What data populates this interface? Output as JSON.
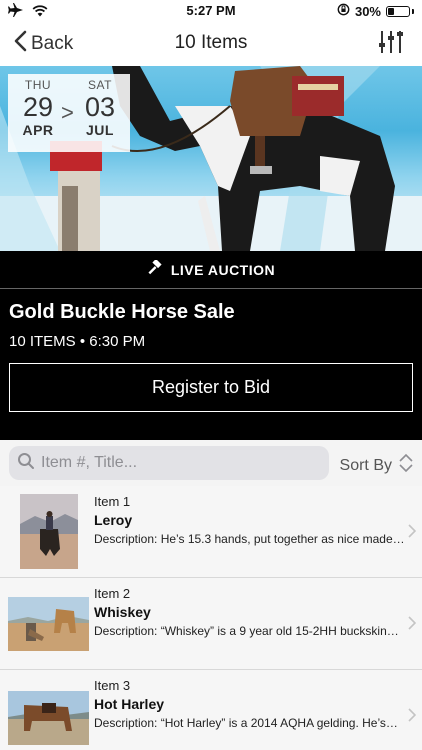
{
  "status_bar": {
    "time": "5:27 PM",
    "battery_text": "30%",
    "battery_level": 0.3,
    "icons": [
      "airplane-icon",
      "wifi-icon",
      "orientation-lock-icon",
      "battery-icon"
    ]
  },
  "nav": {
    "back_label": "Back",
    "title": "10 Items",
    "filter_icon": "sliders-icon"
  },
  "hero": {
    "start": {
      "dow": "THU",
      "day": "29",
      "month": "APR"
    },
    "end": {
      "dow": "SAT",
      "day": "03",
      "month": "JUL"
    },
    "arrow": ">"
  },
  "auction": {
    "badge_label": "LIVE AUCTION",
    "badge_icon": "gavel-icon",
    "title": "Gold Buckle Horse Sale",
    "meta": "10 ITEMS • 6:30 PM",
    "register_label": "Register to Bid"
  },
  "search": {
    "placeholder": "Item #, Title...",
    "value": "",
    "sort_label": "Sort By"
  },
  "items": [
    {
      "number": "Item 1",
      "name": "Leroy",
      "description": "Description: He’s 15.3 hands, put together as nice made…"
    },
    {
      "number": "Item 2",
      "name": "Whiskey",
      "description": "Description: “Whiskey” is a 9 year old 15-2HH buckskin…"
    },
    {
      "number": "Item 3",
      "name": "Hot Harley",
      "description": "Description: “Hot Harley” is a 2014 AQHA gelding. He’s…"
    }
  ],
  "colors": {
    "band_background": "#000000",
    "list_background": "#f6f6f6",
    "search_field": "#e2e2e6"
  }
}
